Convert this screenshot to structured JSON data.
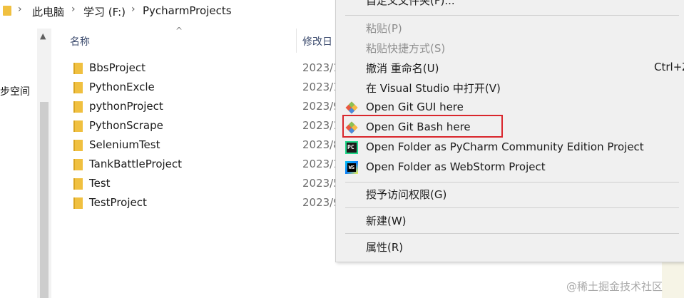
{
  "breadcrumb": {
    "items": [
      "此电脑",
      "学习 (F:)",
      "PycharmProjects"
    ],
    "separator": "›"
  },
  "nav": {
    "partial_label": "步空间"
  },
  "columns": {
    "name": "名称",
    "date": "修改日"
  },
  "files": [
    {
      "name": "BbsProject",
      "date": "2023/1"
    },
    {
      "name": "PythonExcle",
      "date": "2023/1"
    },
    {
      "name": "pythonProject",
      "date": "2023/9"
    },
    {
      "name": "PythonScrape",
      "date": "2023/1"
    },
    {
      "name": "SeleniumTest",
      "date": "2023/8"
    },
    {
      "name": "TankBattleProject",
      "date": "2023/1"
    },
    {
      "name": "Test",
      "date": "2023/5"
    },
    {
      "name": "TestProject",
      "date": "2023/9"
    }
  ],
  "menu": {
    "custom_folder": "自定义文件夹(F)...",
    "paste": "粘贴(P)",
    "paste_shortcut": "粘贴快捷方式(S)",
    "undo_rename": "撤消 重命名(U)",
    "undo_shortcut": "Ctrl+Z",
    "open_vs": "在 Visual Studio 中打开(V)",
    "git_gui": "Open Git GUI here",
    "git_bash": "Open Git Bash here",
    "pycharm": "Open Folder as PyCharm Community Edition Project",
    "webstorm": "Open Folder as WebStorm Project",
    "grant_access": "授予访问权限(G)",
    "new": "新建(W)",
    "properties": "属性(R)"
  },
  "icons": {
    "git": "git-diamond-icon",
    "pycharm": "pycharm-icon",
    "webstorm": "webstorm-icon",
    "folder": "folder-icon"
  },
  "colors": {
    "highlight_border": "#d9262c",
    "folder": "#f0c040",
    "git_diamond": "#e9573f"
  },
  "watermark": "@稀土掘金技术社区"
}
